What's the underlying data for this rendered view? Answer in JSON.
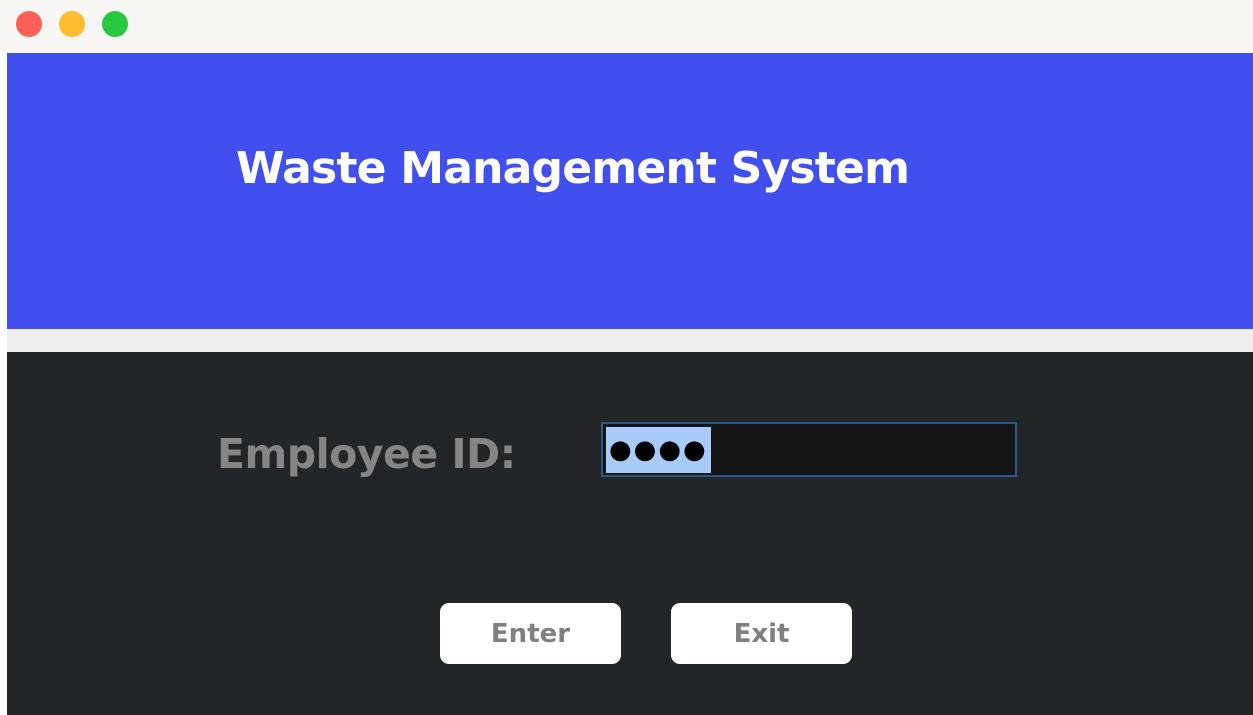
{
  "window": {
    "controls": [
      "close",
      "minimize",
      "maximize"
    ],
    "colors": {
      "close": "#fe5f57",
      "minimize": "#febc2e",
      "maximize": "#28c840",
      "titlebar": "#f7f6f3"
    }
  },
  "header": {
    "title": "Waste Management System",
    "background": "#414fef",
    "text_color": "#ffffff"
  },
  "login": {
    "employee_id_label": "Employee ID:",
    "employee_id_value": "●●●●",
    "panel_background": "#232629",
    "field_selected": true
  },
  "buttons": {
    "enter_label": "Enter",
    "exit_label": "Exit"
  }
}
